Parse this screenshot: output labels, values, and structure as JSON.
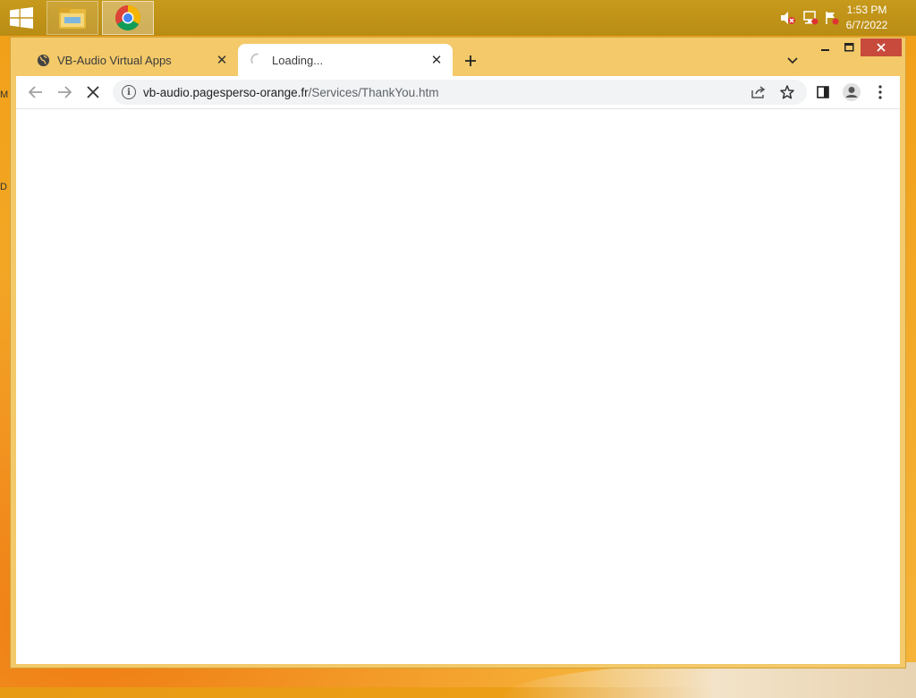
{
  "desktop": {
    "edge_labels": [
      "M",
      "D"
    ]
  },
  "taskbar": {
    "apps": [
      "File Explorer",
      "Google Chrome"
    ],
    "clock": {
      "time": "1:53 PM",
      "date": "6/7/2022"
    }
  },
  "browser": {
    "tabs": [
      {
        "title": "VB-Audio Virtual Apps",
        "active": false,
        "icon": "globe-icon"
      },
      {
        "title": "Loading...",
        "active": true,
        "icon": "loading-spinner-icon"
      }
    ],
    "address": {
      "host": "vb-audio.pagesperso-orange.fr",
      "path": "/Services/ThankYou.htm"
    },
    "window_controls": [
      "minimize",
      "maximize",
      "close"
    ]
  },
  "colors": {
    "taskbar": "#b98c14",
    "window_frame": "#f3c969",
    "close_button": "#c84a3c"
  }
}
